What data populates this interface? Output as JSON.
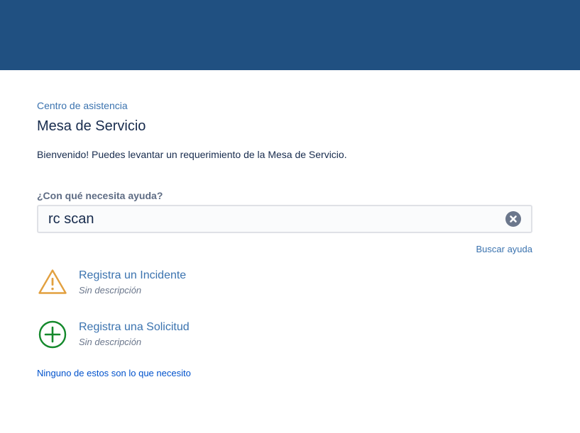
{
  "header": {
    "background_color": "#205081"
  },
  "breadcrumb": {
    "label": "Centro de asistencia"
  },
  "page": {
    "title": "Mesa de Servicio",
    "welcome": "Bienvenido! Puedes levantar un requerimiento de la Mesa de Servicio."
  },
  "search": {
    "label": "¿Con qué necesita ayuda?",
    "value": "rc scan",
    "clear_icon": "clear-icon",
    "help_link": "Buscar ayuda"
  },
  "request_types": [
    {
      "name": "Registra un Incidente",
      "description": "Sin descripción",
      "icon": "warning-triangle-icon",
      "icon_color": "#e2a03f"
    },
    {
      "name": "Registra una Solicitud",
      "description": "Sin descripción",
      "icon": "plus-circle-icon",
      "icon_color": "#14892c"
    }
  ],
  "footer": {
    "none_link": "Ninguno de estos son lo que necesito"
  },
  "colors": {
    "link": "#3b73af",
    "title": "#172b4d"
  }
}
